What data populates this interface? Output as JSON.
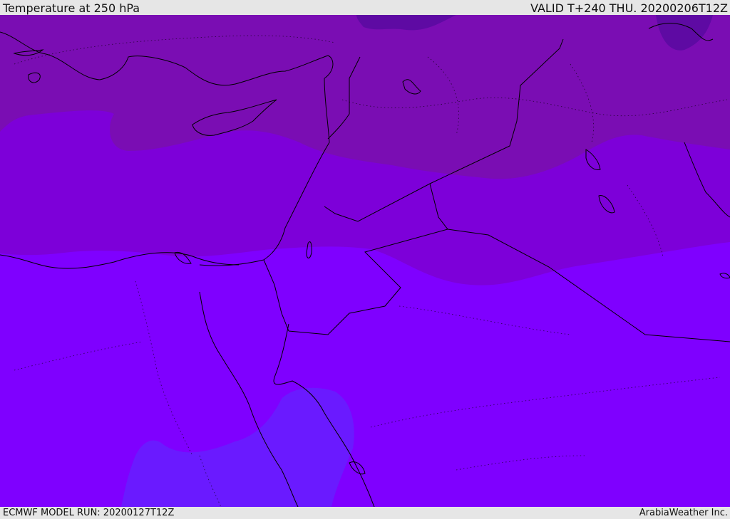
{
  "header": {
    "title": "Temperature at 250 hPa",
    "valid": "VALID T+240 THU. 20200206T12Z"
  },
  "footer": {
    "model_run": "ECMWF MODEL RUN: 20200127T12Z",
    "credit": "ArabiaWeather Inc."
  },
  "map": {
    "shading_colors": {
      "coldest": "#5e0aa3",
      "colder": "#7a0db3",
      "cold": "#7d00d9",
      "base": "#7f00ff",
      "warmest": "#6a1aff"
    },
    "coastline_color": "#000000",
    "border_color": "#000000"
  }
}
